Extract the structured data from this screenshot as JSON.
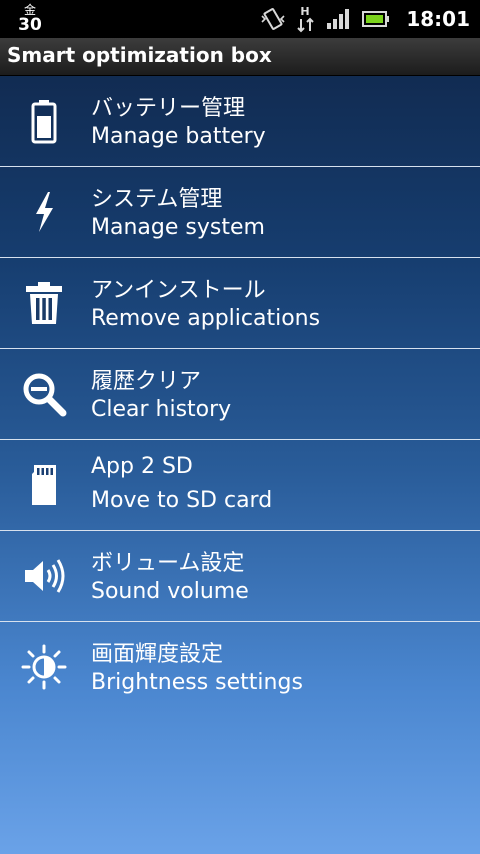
{
  "status_bar": {
    "calendar_top": "金",
    "calendar_day": "30",
    "network_label": "H",
    "time": "18:01",
    "icons": [
      "calendar-icon",
      "vibrate-icon",
      "data-arrows-icon",
      "signal-icon",
      "battery-icon"
    ]
  },
  "header": {
    "title": "Smart optimization box"
  },
  "menu": {
    "items": [
      {
        "jp": "バッテリー管理",
        "en": "Manage battery",
        "icon": "battery-icon"
      },
      {
        "jp": "システム管理",
        "en": "Manage system",
        "icon": "lightning-icon"
      },
      {
        "jp": "アンインストール",
        "en": "Remove applications",
        "icon": "trash-icon"
      },
      {
        "jp": "履歴クリア",
        "en": "Clear history",
        "icon": "magnifier-minus-icon"
      },
      {
        "jp": "App 2 SD",
        "en": "Move to SD card",
        "icon": "sd-card-icon"
      },
      {
        "jp": "ボリューム設定",
        "en": "Sound volume",
        "icon": "speaker-icon"
      },
      {
        "jp": "画面輝度設定",
        "en": "Brightness settings",
        "icon": "brightness-icon"
      }
    ]
  },
  "colors": {
    "statusbar_bg": "#000000",
    "battery_green": "#7bd31c",
    "divider": "#d7e1ee"
  }
}
